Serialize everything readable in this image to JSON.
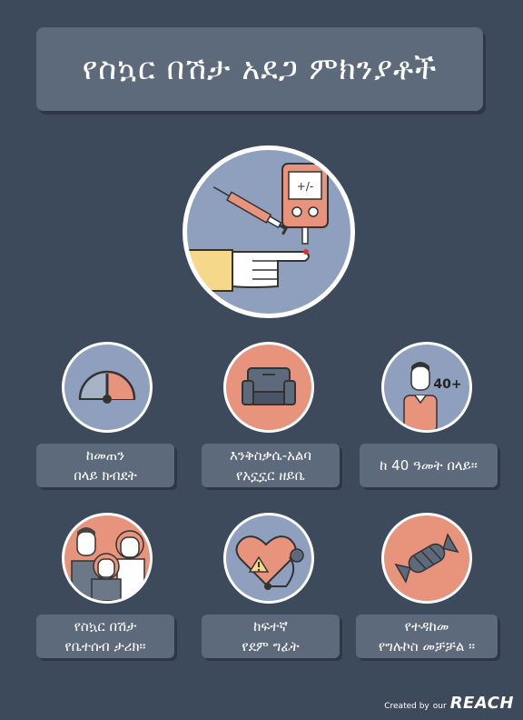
{
  "title": "የስኳር በሽታ አደጋ ምክንያቶች",
  "factors": [
    {
      "line1": "ከመጠን",
      "line2": "በላይ ክብደት"
    },
    {
      "line1": "እንቅስቃሴ-አልባ",
      "line2": "የአኗኗር ዘይቤ"
    },
    {
      "line1": "ከ 40 ዓመት በላይ።",
      "line2": ""
    },
    {
      "line1": "የስኳር በሽታ",
      "line2": "የቤተሰብ ታሪክ።"
    },
    {
      "line1": "ከፍተኛ",
      "line2": "የደም ግፊት"
    },
    {
      "line1": "የተዳከመ",
      "line2": "የግሉኮስ መቻቻል ።"
    }
  ],
  "meter_text": "+/-",
  "age_badge": "40+",
  "credit": {
    "prefix": "Created by",
    "small": "our",
    "brand": "REACH"
  },
  "colors": {
    "background": "#3d4a5c",
    "panel": "#5d6a7c",
    "blue": "#8ea0bd",
    "salmon": "#e8937b"
  }
}
